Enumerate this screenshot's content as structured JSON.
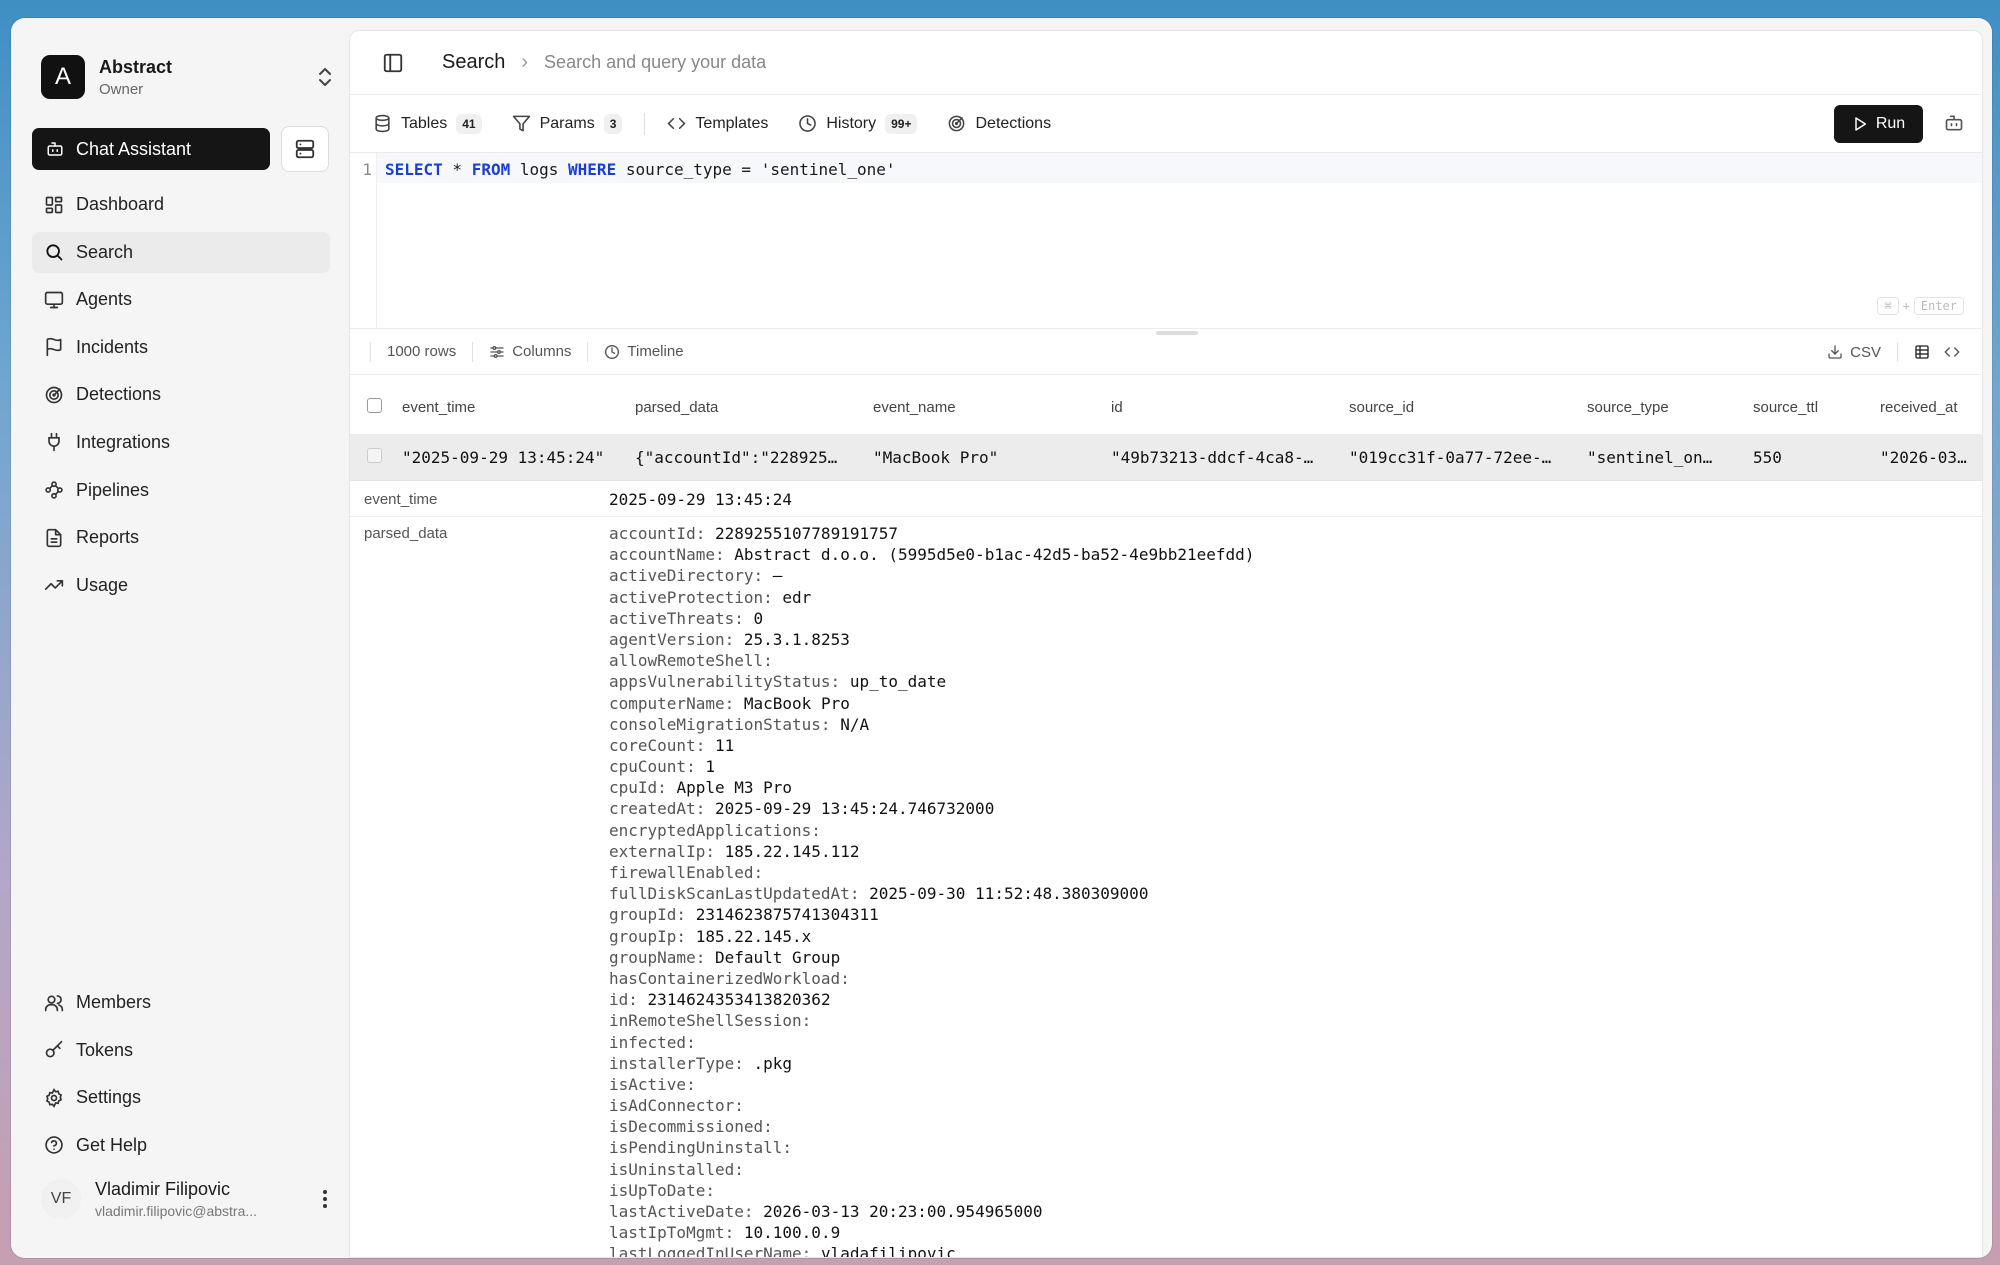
{
  "org": {
    "initial": "A",
    "name": "Abstract",
    "role": "Owner"
  },
  "sidebar": {
    "chat_label": "Chat Assistant",
    "items": [
      {
        "label": "Dashboard",
        "icon": "dashboard-icon"
      },
      {
        "label": "Search",
        "icon": "search-icon",
        "active": true
      },
      {
        "label": "Agents",
        "icon": "monitor-icon"
      },
      {
        "label": "Incidents",
        "icon": "flag-icon"
      },
      {
        "label": "Detections",
        "icon": "radar-icon"
      },
      {
        "label": "Integrations",
        "icon": "plug-icon"
      },
      {
        "label": "Pipelines",
        "icon": "workflow-icon"
      },
      {
        "label": "Reports",
        "icon": "file-icon"
      },
      {
        "label": "Usage",
        "icon": "trending-up-icon"
      }
    ],
    "bottom_items": [
      {
        "label": "Members",
        "icon": "users-icon"
      },
      {
        "label": "Tokens",
        "icon": "key-icon"
      },
      {
        "label": "Settings",
        "icon": "gear-icon"
      },
      {
        "label": "Get Help",
        "icon": "help-icon"
      }
    ]
  },
  "user": {
    "initials": "VF",
    "name": "Vladimir Filipovic",
    "email": "vladimir.filipovic@abstra..."
  },
  "header": {
    "title": "Search",
    "subtitle": "Search and query your data"
  },
  "toolbar": {
    "tables_label": "Tables",
    "tables_count": "41",
    "params_label": "Params",
    "params_count": "3",
    "templates_label": "Templates",
    "history_label": "History",
    "history_count": "99+",
    "detections_label": "Detections",
    "run_label": "Run"
  },
  "editor": {
    "line_number": "1",
    "tokens": [
      {
        "text": "SELECT",
        "kw": true
      },
      {
        "text": " * ",
        "kw": false
      },
      {
        "text": "FROM",
        "kw": true
      },
      {
        "text": " logs ",
        "kw": false
      },
      {
        "text": "WHERE",
        "kw": true
      },
      {
        "text": " source_type = 'sentinel_one'",
        "kw": false
      }
    ],
    "shortcut_key": "⌘",
    "shortcut_plus": "+",
    "shortcut_enter": "Enter"
  },
  "results": {
    "rows_label": "1000 rows",
    "columns_label": "Columns",
    "timeline_label": "Timeline",
    "csv_label": "CSV"
  },
  "table": {
    "columns": [
      "event_time",
      "parsed_data",
      "event_name",
      "id",
      "source_id",
      "source_type",
      "source_ttl",
      "received_at"
    ],
    "row": [
      "\"2025-09-29 13:45:24\"",
      "{\"accountId\":\"228925…",
      "\"MacBook Pro\"",
      "\"49b73213-ddcf-4ca8-…",
      "\"019cc31f-0a77-72ee-…",
      "\"sentinel_on…",
      "550",
      "\"2026-03-…"
    ]
  },
  "detail": {
    "event_time_key": "event_time",
    "event_time_value": "2025-09-29 13:45:24",
    "parsed_key": "parsed_data",
    "parsed": [
      {
        "k": "accountId:",
        "v": "2289255107789191757"
      },
      {
        "k": "accountName:",
        "v": "Abstract d.o.o. (5995d5e0-b1ac-42d5-ba52-4e9bb21eefdd)"
      },
      {
        "k": "activeDirectory:",
        "v": "–"
      },
      {
        "k": "activeProtection:",
        "v": "edr"
      },
      {
        "k": "activeThreats:",
        "v": "0"
      },
      {
        "k": "agentVersion:",
        "v": "25.3.1.8253"
      },
      {
        "k": "allowRemoteShell:",
        "v": ""
      },
      {
        "k": "appsVulnerabilityStatus:",
        "v": "up_to_date"
      },
      {
        "k": "computerName:",
        "v": "MacBook Pro"
      },
      {
        "k": "consoleMigrationStatus:",
        "v": "N/A"
      },
      {
        "k": "coreCount:",
        "v": "11"
      },
      {
        "k": "cpuCount:",
        "v": "1"
      },
      {
        "k": "cpuId:",
        "v": "Apple M3 Pro"
      },
      {
        "k": "createdAt:",
        "v": "2025-09-29 13:45:24.746732000"
      },
      {
        "k": "encryptedApplications:",
        "v": ""
      },
      {
        "k": "externalIp:",
        "v": "185.22.145.112"
      },
      {
        "k": "firewallEnabled:",
        "v": ""
      },
      {
        "k": "fullDiskScanLastUpdatedAt:",
        "v": "2025-09-30 11:52:48.380309000"
      },
      {
        "k": "groupId:",
        "v": "2314623875741304311"
      },
      {
        "k": "groupIp:",
        "v": "185.22.145.x"
      },
      {
        "k": "groupName:",
        "v": "Default Group"
      },
      {
        "k": "hasContainerizedWorkload:",
        "v": ""
      },
      {
        "k": "id:",
        "v": "2314624353413820362"
      },
      {
        "k": "inRemoteShellSession:",
        "v": ""
      },
      {
        "k": "infected:",
        "v": ""
      },
      {
        "k": "installerType:",
        "v": ".pkg"
      },
      {
        "k": "isActive:",
        "v": ""
      },
      {
        "k": "isAdConnector:",
        "v": ""
      },
      {
        "k": "isDecommissioned:",
        "v": ""
      },
      {
        "k": "isPendingUninstall:",
        "v": ""
      },
      {
        "k": "isUninstalled:",
        "v": ""
      },
      {
        "k": "isUpToDate:",
        "v": ""
      },
      {
        "k": "lastActiveDate:",
        "v": "2026-03-13 20:23:00.954965000"
      },
      {
        "k": "lastIpToMgmt:",
        "v": "10.100.0.9"
      },
      {
        "k": "lastLoggedInUserName:",
        "v": "vladafilipovic"
      }
    ]
  }
}
